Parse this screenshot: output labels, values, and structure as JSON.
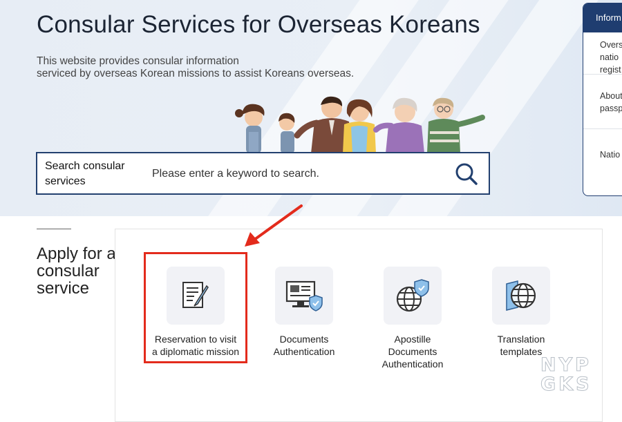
{
  "page": {
    "title": "Consular Services for Overseas Koreans",
    "description_lines": [
      "This website provides consular information",
      "serviced by overseas Korean missions to assist Koreans overseas."
    ]
  },
  "search": {
    "label": "Search consular services",
    "placeholder": "Please enter a keyword to search.",
    "icon": "search-icon"
  },
  "info_panel": {
    "header": "Inform",
    "items": [
      [
        "Overs",
        "natio",
        "regist"
      ],
      [
        "About",
        "passp"
      ],
      [
        "Natio"
      ]
    ]
  },
  "apply": {
    "heading": "Apply for a consular service",
    "services": [
      {
        "label_lines": [
          "Reservation to visit",
          "a diplomatic mission"
        ],
        "icon": "document-edit-icon",
        "highlighted": true
      },
      {
        "label_lines": [
          "Documents",
          "Authentication"
        ],
        "icon": "computer-shield-icon",
        "highlighted": false
      },
      {
        "label_lines": [
          "Apostille",
          "Documents",
          "Authentication"
        ],
        "icon": "globe-shield-icon",
        "highlighted": false
      },
      {
        "label_lines": [
          "Translation",
          "templates"
        ],
        "icon": "globe-translation-icon",
        "highlighted": false
      }
    ]
  },
  "annotation": {
    "highlight_color": "#e32b1c"
  },
  "watermark": [
    "NYP",
    "GKS"
  ],
  "colors": {
    "brand_navy": "#1f3d70",
    "hero_bg": "#e7edf5",
    "tile_bg": "#f1f2f6"
  }
}
